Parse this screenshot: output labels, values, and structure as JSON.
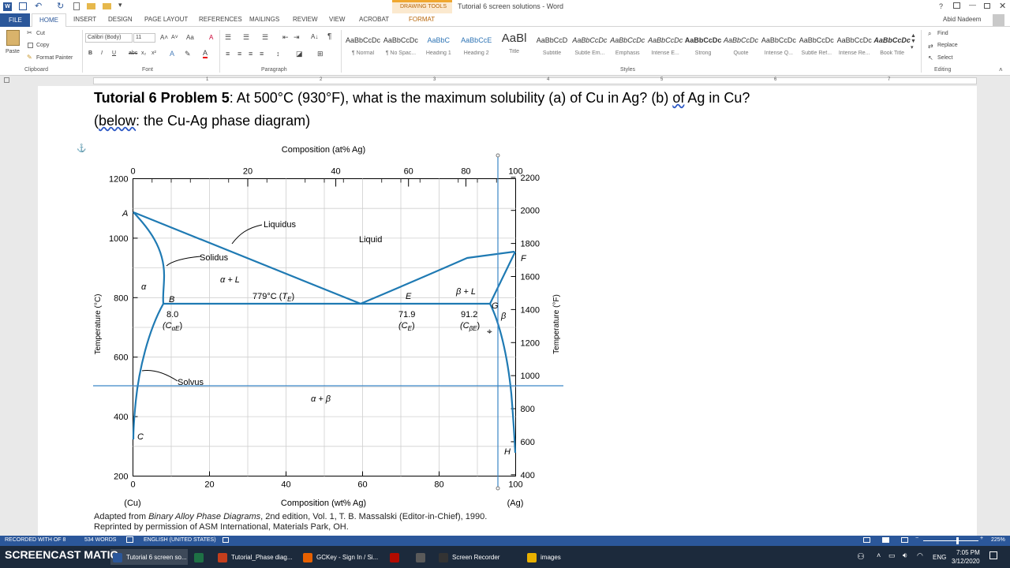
{
  "window": {
    "document_title": "Tutorial 6 screen solutions - Word",
    "contextual_tab_group": "DRAWING TOOLS",
    "help": "?",
    "user": "Abid Nadeem"
  },
  "tabs": [
    "HOME",
    "INSERT",
    "DESIGN",
    "PAGE LAYOUT",
    "REFERENCES",
    "MAILINGS",
    "REVIEW",
    "VIEW",
    "ACROBAT",
    "FORMAT"
  ],
  "file_tab": "FILE",
  "ribbon": {
    "clipboard": {
      "paste": "Paste",
      "cut": "Cut",
      "copy": "Copy",
      "format_painter": "Format Painter",
      "label": "Clipboard"
    },
    "font": {
      "name": "Calibri (Body)",
      "size": "11",
      "label": "Font",
      "bold": "B",
      "italic": "I",
      "underline": "U"
    },
    "paragraph": {
      "label": "Paragraph"
    },
    "styles": {
      "label": "Styles",
      "items": [
        {
          "sample": "AaBbCcDc",
          "name": "¶ Normal"
        },
        {
          "sample": "AaBbCcDc",
          "name": "¶ No Spac..."
        },
        {
          "sample": "AaBbC",
          "name": "Heading 1"
        },
        {
          "sample": "AaBbCcE",
          "name": "Heading 2"
        },
        {
          "sample": "AaBl",
          "name": "Title"
        },
        {
          "sample": "AaBbCcD",
          "name": "Subtitle"
        },
        {
          "sample": "AaBbCcDc",
          "name": "Subtle Em..."
        },
        {
          "sample": "AaBbCcDc",
          "name": "Emphasis"
        },
        {
          "sample": "AaBbCcDc",
          "name": "Intense E..."
        },
        {
          "sample": "AaBbCcDc",
          "name": "Strong"
        },
        {
          "sample": "AaBbCcDc",
          "name": "Quote"
        },
        {
          "sample": "AaBbCcDc",
          "name": "Intense Q..."
        },
        {
          "sample": "AaBbCcDc",
          "name": "Subtle Ref..."
        },
        {
          "sample": "AaBbCcDc",
          "name": "Intense Re..."
        },
        {
          "sample": "AaBbCcDc",
          "name": "Book Title"
        }
      ]
    },
    "editing": {
      "find": "Find",
      "replace": "Replace",
      "select": "Select",
      "label": "Editing"
    }
  },
  "ruler": [
    "1",
    "2",
    "3",
    "4",
    "5",
    "6",
    "7"
  ],
  "document": {
    "heading_bold": "Tutorial 6 Problem 5",
    "heading_line1": ": At 500°C (930°F), what is the maximum solubility (a) of Cu in Ag? (b) ",
    "heading_of": "of",
    "heading_line1_end": " Ag in Cu?",
    "heading_line2_open": "(",
    "heading_below": "below",
    "heading_line2_rest": ": the Cu-Ag phase diagram)",
    "caption_line1_a": "Adapted from ",
    "caption_line1_italic": "Binary Alloy Phase Diagrams",
    "caption_line1_b": ", 2nd edition, Vol. 1, T. B. Massalski (Editor-in-Chief), 1990.",
    "caption_line2": "Reprinted by permission of ASM International, Materials Park, OH."
  },
  "diagram": {
    "top_axis_title": "Composition (at% Ag)",
    "top_ticks": [
      "0",
      "20",
      "40",
      "60",
      "80",
      "100"
    ],
    "bottom_axis_title": "Composition (wt% Ag)",
    "bottom_ticks": [
      "0",
      "20",
      "40",
      "60",
      "80",
      "100"
    ],
    "bottom_left_label": "(Cu)",
    "bottom_right_label": "(Ag)",
    "left_axis_title": "Temperature (°C)",
    "left_ticks": [
      "1200",
      "1000",
      "800",
      "600",
      "400",
      "200"
    ],
    "right_axis_title": "Temperature (°F)",
    "right_ticks": [
      "2200",
      "2000",
      "1800",
      "1600",
      "1400",
      "1200",
      "1000",
      "800",
      "600",
      "400"
    ],
    "points": {
      "A": "A",
      "B": "B",
      "C": "C",
      "E": "E",
      "F": "F",
      "G": "G",
      "H": "H"
    },
    "labels": {
      "liquidus": "Liquidus",
      "liquid": "Liquid",
      "solidus": "Solidus",
      "solvus": "Solvus",
      "alpha": "α",
      "alpha_l": "α + L",
      "beta_l": "β + L",
      "beta": "β",
      "alpha_beta": "α + β",
      "eutectic_temp": "779°C (",
      "eutectic_temp_t": "T",
      "eutectic_temp_sub": "E",
      "eutectic_temp_close": ")",
      "c_alpha_val": "8.0",
      "c_alpha_sym": "(C",
      "c_alpha_sub": "αE",
      "c_alpha_close": ")",
      "c_e_val": "71.9",
      "c_e_sym": "(C",
      "c_e_sub": "E",
      "c_e_close": ")",
      "c_beta_val": "91.2",
      "c_beta_sym": "(C",
      "c_beta_sub": "βE",
      "c_beta_close": ")"
    }
  },
  "statusbar": {
    "page": "RECORDED WITH   OF 8",
    "words": "534 WORDS",
    "language": "ENGLISH (UNITED STATES)",
    "zoom": "225%"
  },
  "watermark": "SCREENCAST  MATIC",
  "taskbar": {
    "apps": [
      {
        "label": "Tutorial 6 screen so...",
        "color": "#2b579a"
      },
      {
        "label": "",
        "color": "#1e7145"
      },
      {
        "label": "Tutorial_Phase diag...",
        "color": "#c43e1c"
      },
      {
        "label": "GCKey - Sign In / Si...",
        "color": "#e66000"
      },
      {
        "label": "",
        "color": "#b30b00"
      },
      {
        "label": "",
        "color": "#5a5a5a"
      },
      {
        "label": "Screen Recorder",
        "color": "#333333"
      },
      {
        "label": "images",
        "color": "#e8b000"
      }
    ],
    "lang": "ENG",
    "time": "7:05 PM",
    "date": "3/12/2020"
  }
}
